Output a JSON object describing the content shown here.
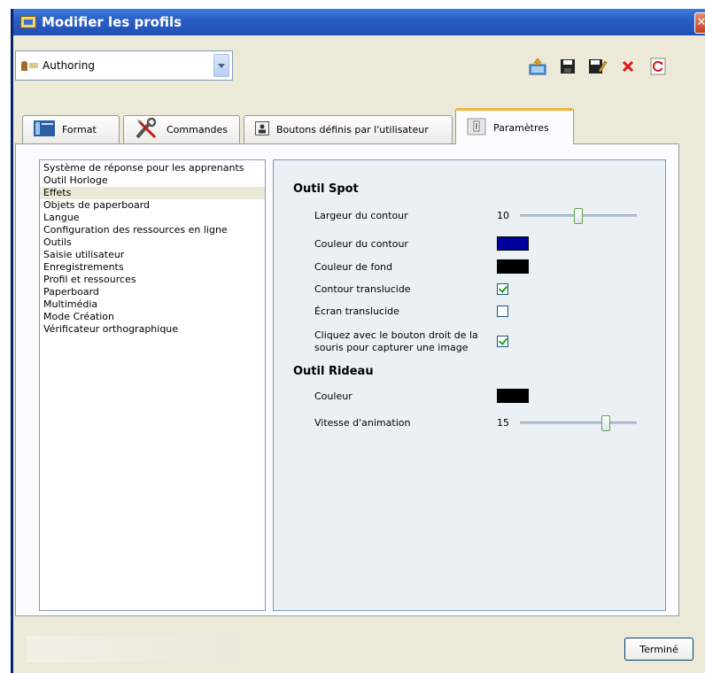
{
  "window": {
    "title": "Modifier les profils"
  },
  "profile": {
    "selected": "Authoring"
  },
  "toolbar": {
    "icons": [
      "export-icon",
      "save-icon",
      "edit-save-icon",
      "delete-icon",
      "refresh-icon"
    ]
  },
  "tabs": [
    {
      "label": "Format"
    },
    {
      "label": "Commandes"
    },
    {
      "label": "Boutons définis par l'utilisateur"
    },
    {
      "label": "Paramètres"
    }
  ],
  "categories": [
    "Système de réponse pour les apprenants",
    "Outil Horloge",
    "Effets",
    "Objets de paperboard",
    "Langue",
    "Configuration des ressources en ligne",
    "Outils",
    "Saisie utilisateur",
    "Enregistrements",
    "Profil et ressources",
    "Paperboard",
    "Multimédia",
    "Mode Création",
    "Vérificateur orthographique"
  ],
  "selected_category": "Effets",
  "spot": {
    "title": "Outil Spot",
    "border_width_label": "Largeur du contour",
    "border_width_value": "10",
    "border_width_level": 0.5,
    "border_color_label": "Couleur du contour",
    "border_color": "#00009c",
    "fill_color_label": "Couleur de fond",
    "fill_color": "#000000",
    "translucent_border_label": "Contour translucide",
    "translucent_border": true,
    "translucent_screen_label": "Écran translucide",
    "translucent_screen": false,
    "right_click_label_1": "Cliquez avec le bouton droit de la",
    "right_click_label_2": "souris pour capturer une image",
    "right_click": true
  },
  "curtain": {
    "title": "Outil Rideau",
    "color_label": "Couleur",
    "color": "#000000",
    "speed_label": "Vitesse d'animation",
    "speed_value": "15",
    "speed_level": 0.75
  },
  "footer": {
    "done_label": "Terminé"
  }
}
